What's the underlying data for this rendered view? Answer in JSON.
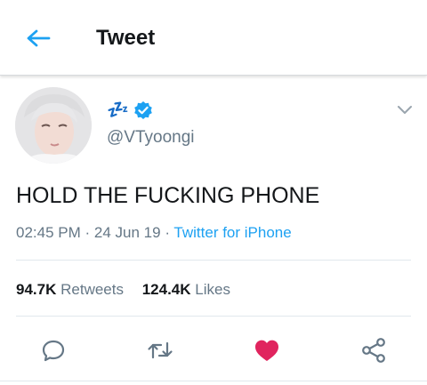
{
  "header": {
    "title": "Tweet",
    "back_icon": "arrow-left-icon"
  },
  "tweet": {
    "display_name": "💤",
    "handle": "@VTyoongi",
    "verified": true,
    "text": "HOLD THE FUCKING PHONE",
    "time": "02:45 PM",
    "date": "24 Jun 19",
    "separator": "·",
    "source": "Twitter for iPhone"
  },
  "stats": {
    "retweets_count": "94.7K",
    "retweets_label": "Retweets",
    "likes_count": "124.4K",
    "likes_label": "Likes"
  },
  "actions": [
    "reply-icon",
    "retweet-icon",
    "like-icon",
    "share-icon"
  ],
  "colors": {
    "accent": "#1da1f2",
    "like": "#e0245e",
    "muted": "#657786",
    "text": "#14171a",
    "verified": "#1da1f2",
    "zzz": "#2f6fd6"
  }
}
